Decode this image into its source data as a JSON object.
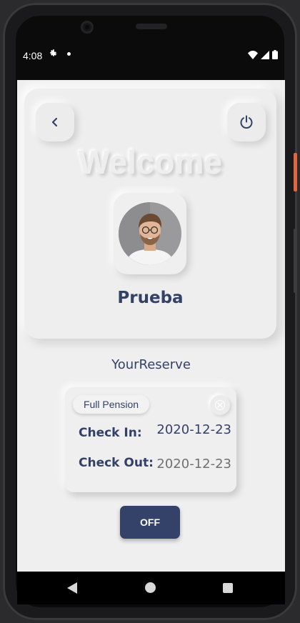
{
  "status_bar": {
    "time": "4:08",
    "icons": [
      "settings-icon",
      "notification-dot",
      "wifi-icon",
      "signal-icon",
      "battery-icon"
    ]
  },
  "header": {
    "welcome_text": "Welcome",
    "user_name": "Prueba",
    "back_icon": "chevron-left-icon",
    "power_icon": "power-icon"
  },
  "reserve": {
    "section_title": "YourReserve",
    "pension_type": "Full Pension",
    "check_in_label": "Check In:",
    "check_in_value": "2020-12-23",
    "check_out_label": "Check Out:",
    "check_out_value": "2020-12-23"
  },
  "actions": {
    "off_label": "OFF"
  },
  "colors": {
    "primary": "#34426a",
    "text_dark": "#334166",
    "background": "#efefef",
    "muted_text": "#707070"
  },
  "nav_bar": {
    "icons": [
      "back-triangle-icon",
      "home-circle-icon",
      "recents-square-icon"
    ]
  }
}
